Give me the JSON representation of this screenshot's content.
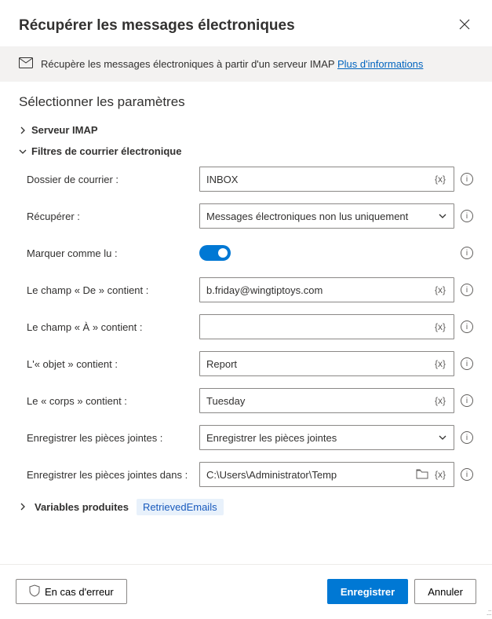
{
  "header": {
    "title": "Récupérer les messages électroniques",
    "close_tooltip": "Fermer"
  },
  "info": {
    "text": "Récupère les messages électroniques à partir d'un serveur IMAP ",
    "link": "Plus d'informations"
  },
  "section_title": "Sélectionner les paramètres",
  "groups": {
    "imap": "Serveur IMAP",
    "filters": "Filtres de courrier électronique",
    "vars": "Variables produites"
  },
  "labels": {
    "folder": "Dossier de courrier :",
    "retrieve": "Récupérer :",
    "markread": "Marquer comme lu :",
    "from": "Le champ « De » contient :",
    "to": "Le champ « À » contient :",
    "subject": "L'« objet » contient :",
    "body": "Le « corps » contient :",
    "saveatt": "Enregistrer les pièces jointes :",
    "saveattinto": "Enregistrer les pièces jointes dans :"
  },
  "values": {
    "folder": "INBOX",
    "retrieve": "Messages électroniques non lus uniquement",
    "from": "b.friday@wingtiptoys.com",
    "to": "",
    "subject": "Report",
    "body": "Tuesday",
    "saveatt": "Enregistrer les pièces jointes",
    "saveattinto": "C:\\Users\\Administrator\\Temp"
  },
  "var_token": "{x}",
  "var_chip": "RetrievedEmails",
  "footer": {
    "onerror": "En cas d'erreur",
    "save": "Enregistrer",
    "cancel": "Annuler"
  }
}
